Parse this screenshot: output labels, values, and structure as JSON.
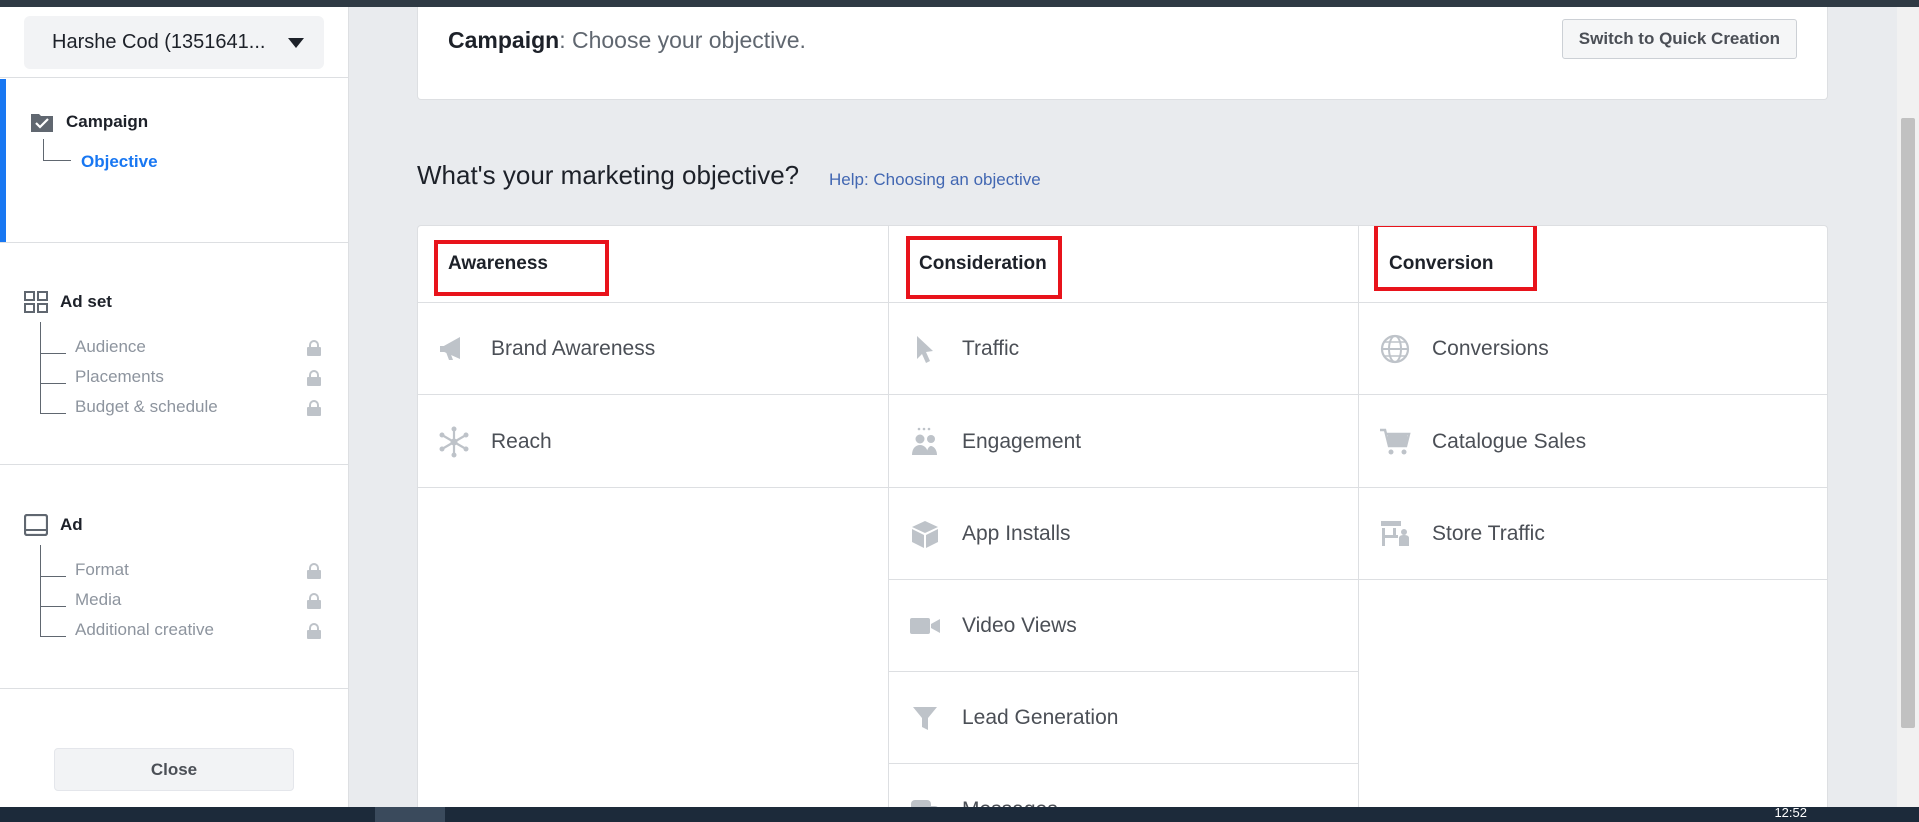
{
  "sidebar": {
    "account_name": "Harshe Cod (1351641...",
    "campaign": {
      "title": "Campaign",
      "items": [
        {
          "label": "Objective"
        }
      ]
    },
    "adset": {
      "title": "Ad set",
      "items": [
        {
          "label": "Audience"
        },
        {
          "label": "Placements"
        },
        {
          "label": "Budget & schedule"
        }
      ]
    },
    "ad": {
      "title": "Ad",
      "items": [
        {
          "label": "Format"
        },
        {
          "label": "Media"
        },
        {
          "label": "Additional creative"
        }
      ]
    },
    "close_label": "Close"
  },
  "header": {
    "title_bold": "Campaign",
    "title_rest": ": Choose your objective.",
    "quick_creation_label": "Switch to Quick Creation"
  },
  "objective_question": "What's your marketing objective?",
  "help_link": "Help: Choosing an objective",
  "columns": [
    {
      "title": "Awareness",
      "items": [
        {
          "label": "Brand Awareness",
          "icon": "megaphone-icon"
        },
        {
          "label": "Reach",
          "icon": "reach-icon"
        }
      ]
    },
    {
      "title": "Consideration",
      "items": [
        {
          "label": "Traffic",
          "icon": "cursor-icon"
        },
        {
          "label": "Engagement",
          "icon": "people-icon"
        },
        {
          "label": "App Installs",
          "icon": "box-icon"
        },
        {
          "label": "Video Views",
          "icon": "video-camera-icon"
        },
        {
          "label": "Lead Generation",
          "icon": "funnel-icon"
        },
        {
          "label": "Messages",
          "icon": "chat-icon"
        }
      ]
    },
    {
      "title": "Conversion",
      "items": [
        {
          "label": "Conversions",
          "icon": "globe-icon"
        },
        {
          "label": "Catalogue Sales",
          "icon": "cart-icon"
        },
        {
          "label": "Store Traffic",
          "icon": "store-icon"
        }
      ]
    }
  ],
  "taskbar": {
    "clock": "12:52"
  },
  "colors": {
    "accent": "#1877f2",
    "highlight": "#e8131b",
    "link": "#4267b2"
  }
}
